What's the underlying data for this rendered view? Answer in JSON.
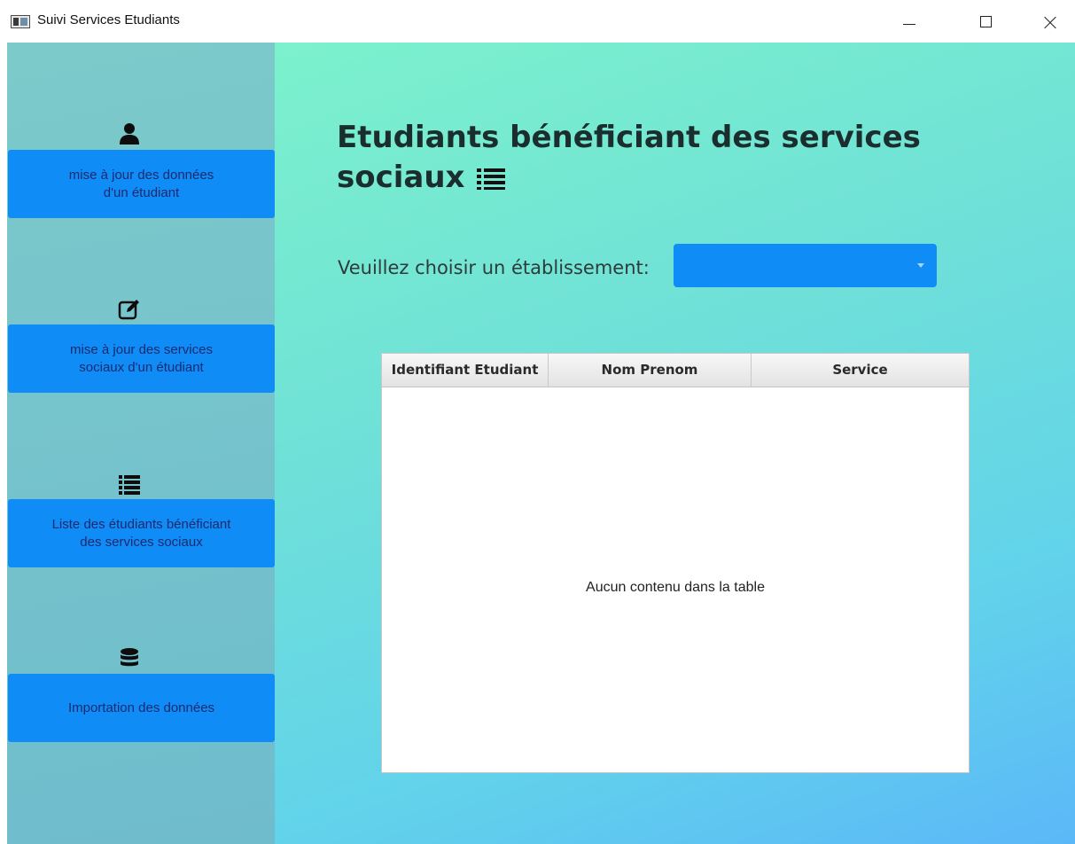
{
  "window": {
    "title": "Suivi Services Etudiants"
  },
  "sidebar": {
    "items": [
      {
        "icon": "user-icon",
        "lines": [
          "mise à jour des données",
          "d'un étudiant"
        ]
      },
      {
        "icon": "edit-icon",
        "lines": [
          "mise à jour des services",
          "sociaux d'un étudiant"
        ]
      },
      {
        "icon": "list-icon",
        "lines": [
          "Liste des étudiants bénéficiant",
          "des services sociaux"
        ]
      },
      {
        "icon": "database-icon",
        "lines": [
          "Importation des données"
        ]
      }
    ]
  },
  "main": {
    "heading_line1": "Etudiants bénéficiant des services",
    "heading_line2": "sociaux",
    "heading_icon": "list-icon",
    "choose_label": "Veuillez choisir un établissement:",
    "establishment_select": {
      "value": ""
    },
    "table": {
      "columns": [
        "Identifiant Etudiant",
        "Nom Prenom",
        "Service"
      ],
      "rows": [],
      "empty_message": "Aucun contenu dans la table"
    }
  },
  "colors": {
    "accent": "#0f8cf5",
    "sidebar": "#74c4cb",
    "nav_text": "#1c2a70"
  }
}
